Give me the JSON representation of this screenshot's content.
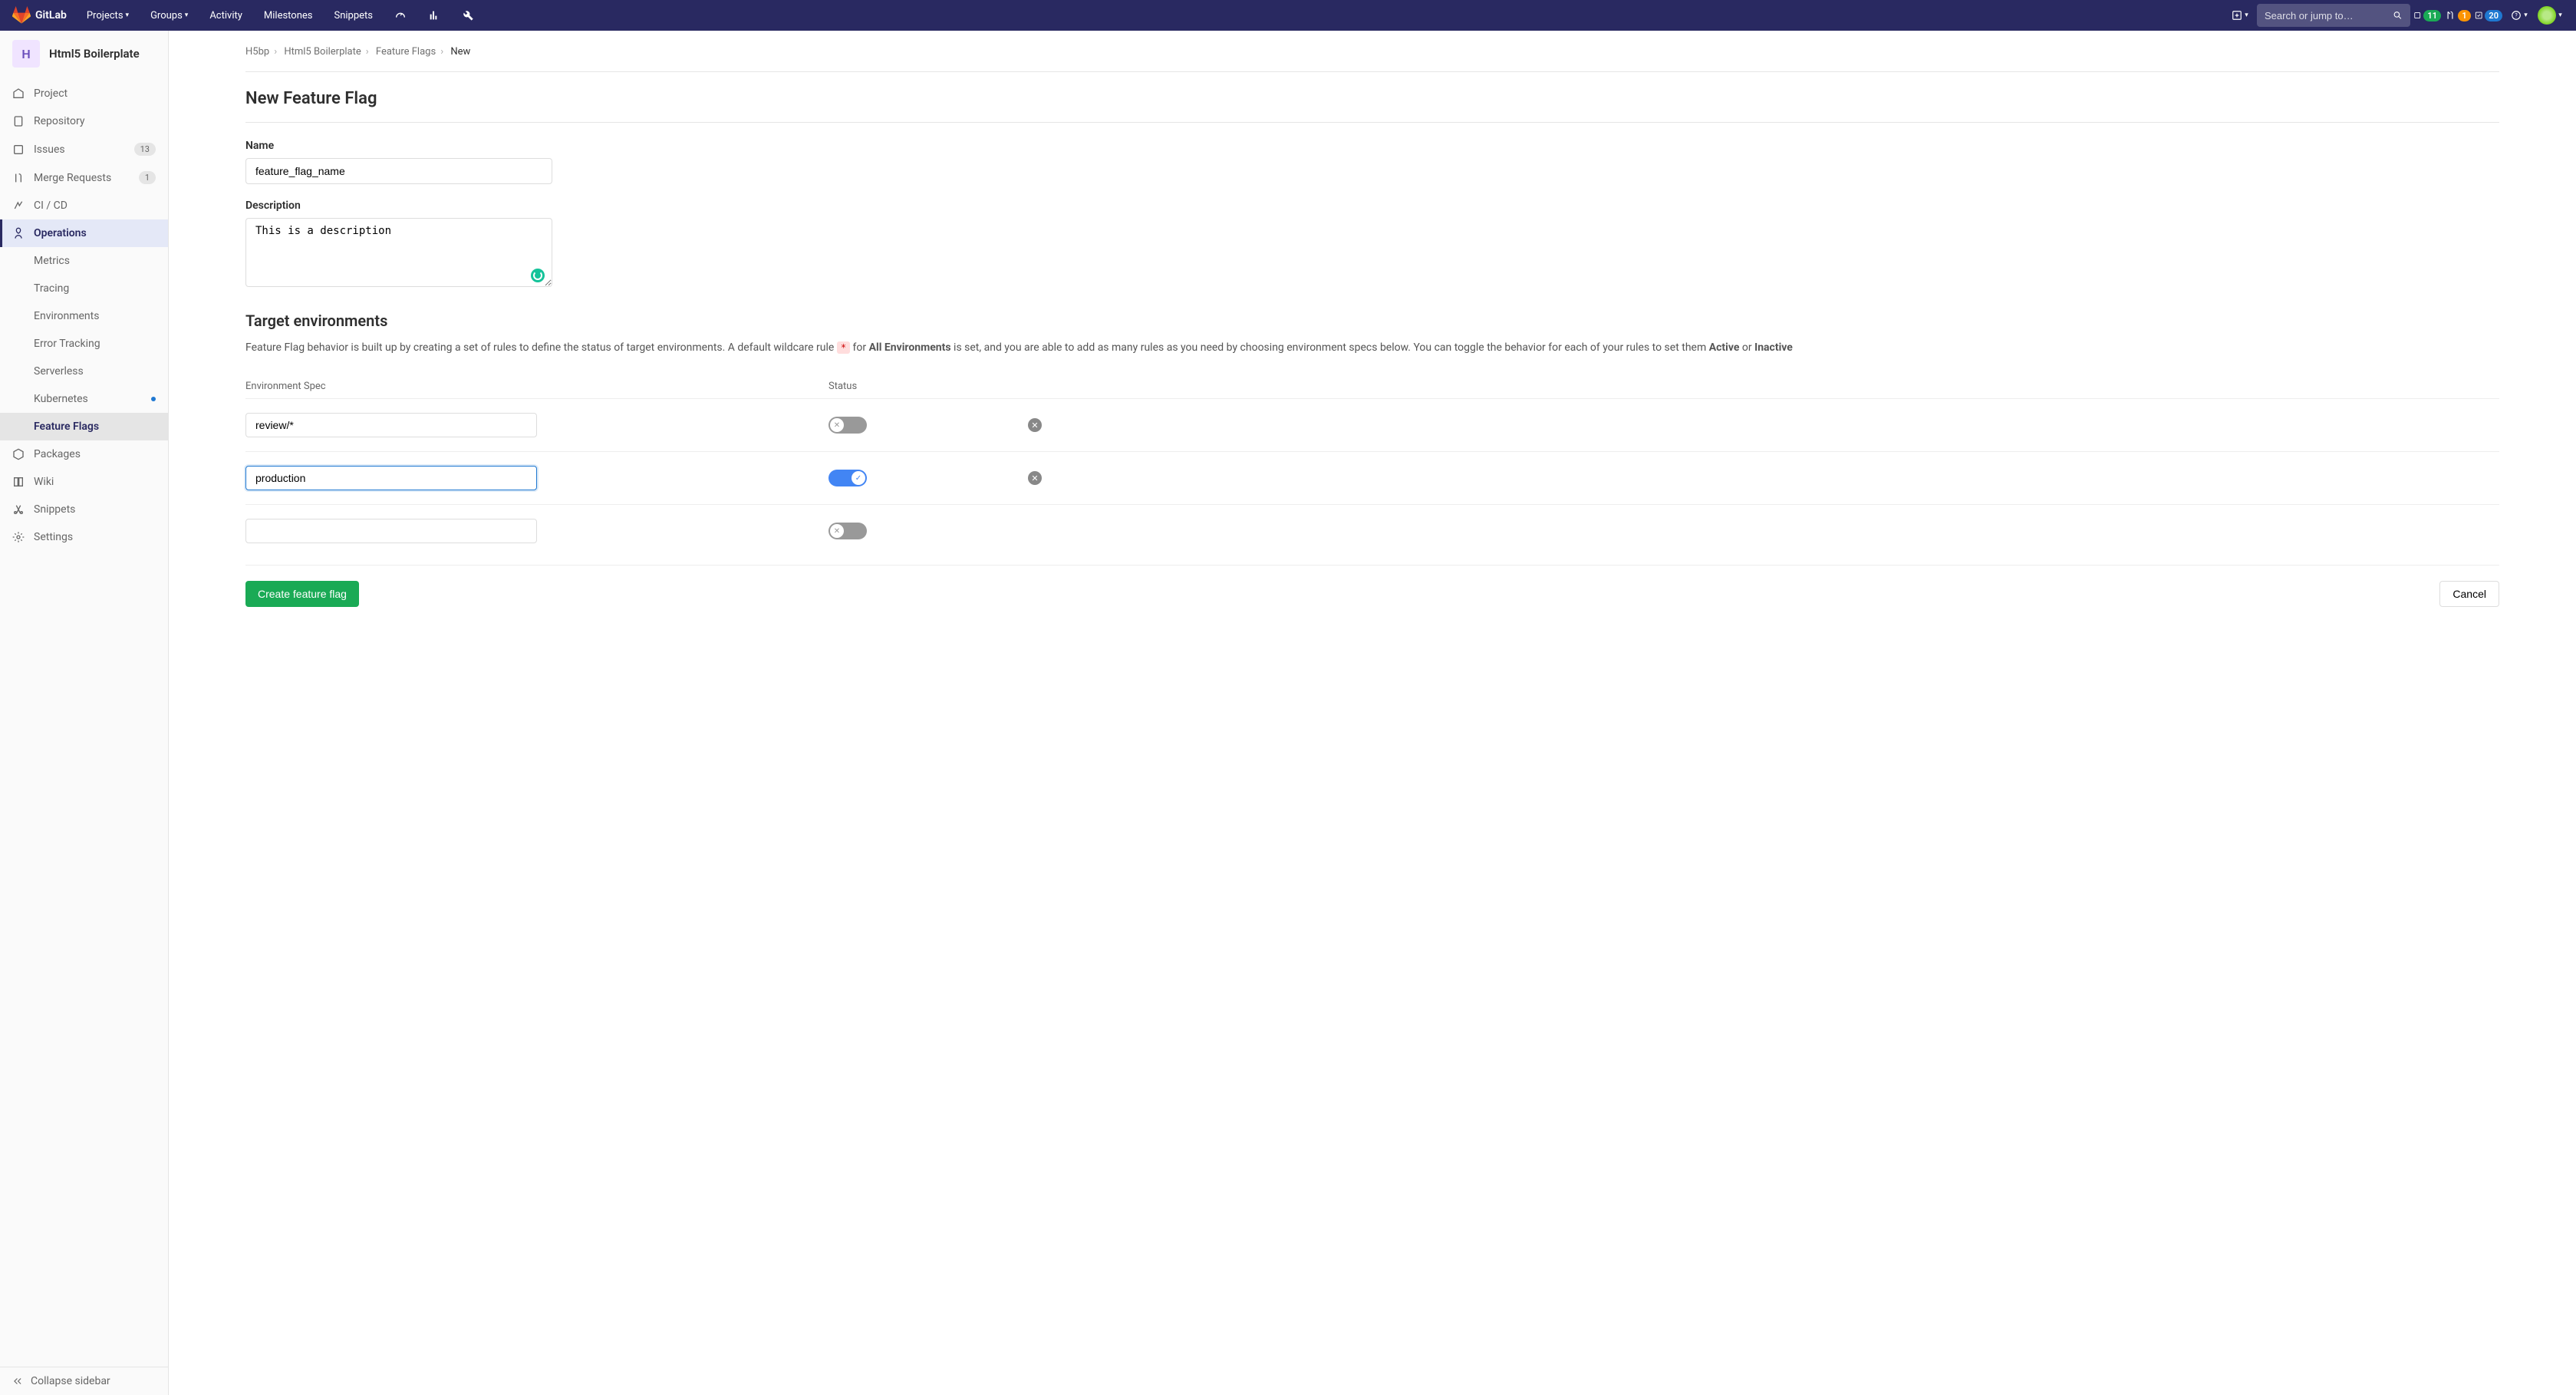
{
  "header": {
    "brand": "GitLab",
    "nav": {
      "projects": "Projects",
      "groups": "Groups",
      "activity": "Activity",
      "milestones": "Milestones",
      "snippets": "Snippets"
    },
    "search_placeholder": "Search or jump to…",
    "issues_count": "11",
    "mr_count": "1",
    "todos_count": "20"
  },
  "sidebar": {
    "project_letter": "H",
    "project_name": "Html5 Boilerplate",
    "items": {
      "project": "Project",
      "repository": "Repository",
      "issues": "Issues",
      "issues_count": "13",
      "merge_requests": "Merge Requests",
      "mr_count": "1",
      "cicd": "CI / CD",
      "operations": "Operations",
      "packages": "Packages",
      "wiki": "Wiki",
      "snippets": "Snippets",
      "settings": "Settings"
    },
    "operations_sub": {
      "metrics": "Metrics",
      "tracing": "Tracing",
      "environments": "Environments",
      "error_tracking": "Error Tracking",
      "serverless": "Serverless",
      "kubernetes": "Kubernetes",
      "feature_flags": "Feature Flags"
    },
    "collapse": "Collapse sidebar"
  },
  "breadcrumb": {
    "group": "H5bp",
    "project": "Html5 Boilerplate",
    "section": "Feature Flags",
    "current": "New"
  },
  "main": {
    "title": "New Feature Flag",
    "name_label": "Name",
    "name_value": "feature_flag_name",
    "desc_label": "Description",
    "desc_value": "This is a description",
    "target_title": "Target environments",
    "help_p1": "Feature Flag behavior is built up by creating a set of rules to define the status of target environments. A default wildcare rule ",
    "help_wildcard": "*",
    "help_p2": " for ",
    "help_allenv": "All Environments",
    "help_p3": " is set, and you are able to add as many rules as you need by choosing environment specs below. You can toggle the behavior for each of your rules to set them ",
    "help_active": "Active",
    "help_or": " or ",
    "help_inactive": "Inactive",
    "col_spec": "Environment Spec",
    "col_status": "Status",
    "rows": [
      {
        "spec": "review/*",
        "active": false,
        "deletable": true
      },
      {
        "spec": "production",
        "active": true,
        "deletable": true,
        "focused": true
      },
      {
        "spec": "",
        "active": false,
        "deletable": false
      }
    ],
    "create_btn": "Create feature flag",
    "cancel_btn": "Cancel"
  }
}
